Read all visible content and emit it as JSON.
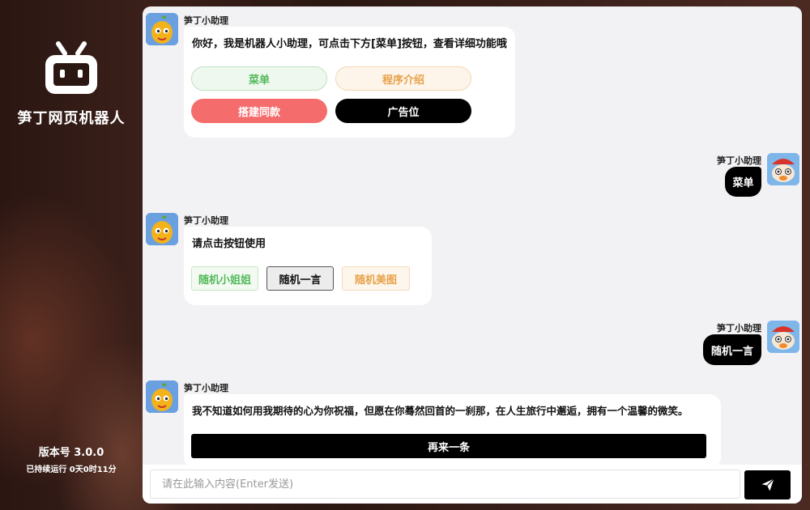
{
  "sidebar": {
    "app_name": "笋丁网页机器人",
    "version": "版本号 3.0.0",
    "uptime": "已持续运行 0天0时11分",
    "logo_icon": "robot-tv-icon"
  },
  "messages": {
    "m1": {
      "sender": "笋丁小助理",
      "text": "你好，我是机器人小助理，可点击下方[菜单]按钮，查看详细功能哦",
      "buttons": [
        "菜单",
        "程序介绍",
        "搭建同款",
        "广告位"
      ]
    },
    "u1": {
      "sender": "笋丁小助理",
      "text": "菜单"
    },
    "m2": {
      "sender": "笋丁小助理",
      "text": "请点击按钮使用",
      "buttons": [
        "随机小姐姐",
        "随机一言",
        "随机美图"
      ]
    },
    "u2": {
      "sender": "笋丁小助理",
      "text": "随机一言"
    },
    "m3": {
      "sender": "笋丁小助理",
      "text": "我不知道如何用我期待的心为你祝福，但愿在你蓦然回首的一刹那，在人生旅行中邂逅，拥有一个温馨的微笑。",
      "button": "再来一条"
    }
  },
  "input": {
    "placeholder": "请在此输入内容(Enter发送)",
    "value": "",
    "send_icon": "send-icon"
  },
  "colors": {
    "green": "#52b95a",
    "orange": "#e8a24a",
    "red": "#f56c6c",
    "black": "#000000"
  }
}
